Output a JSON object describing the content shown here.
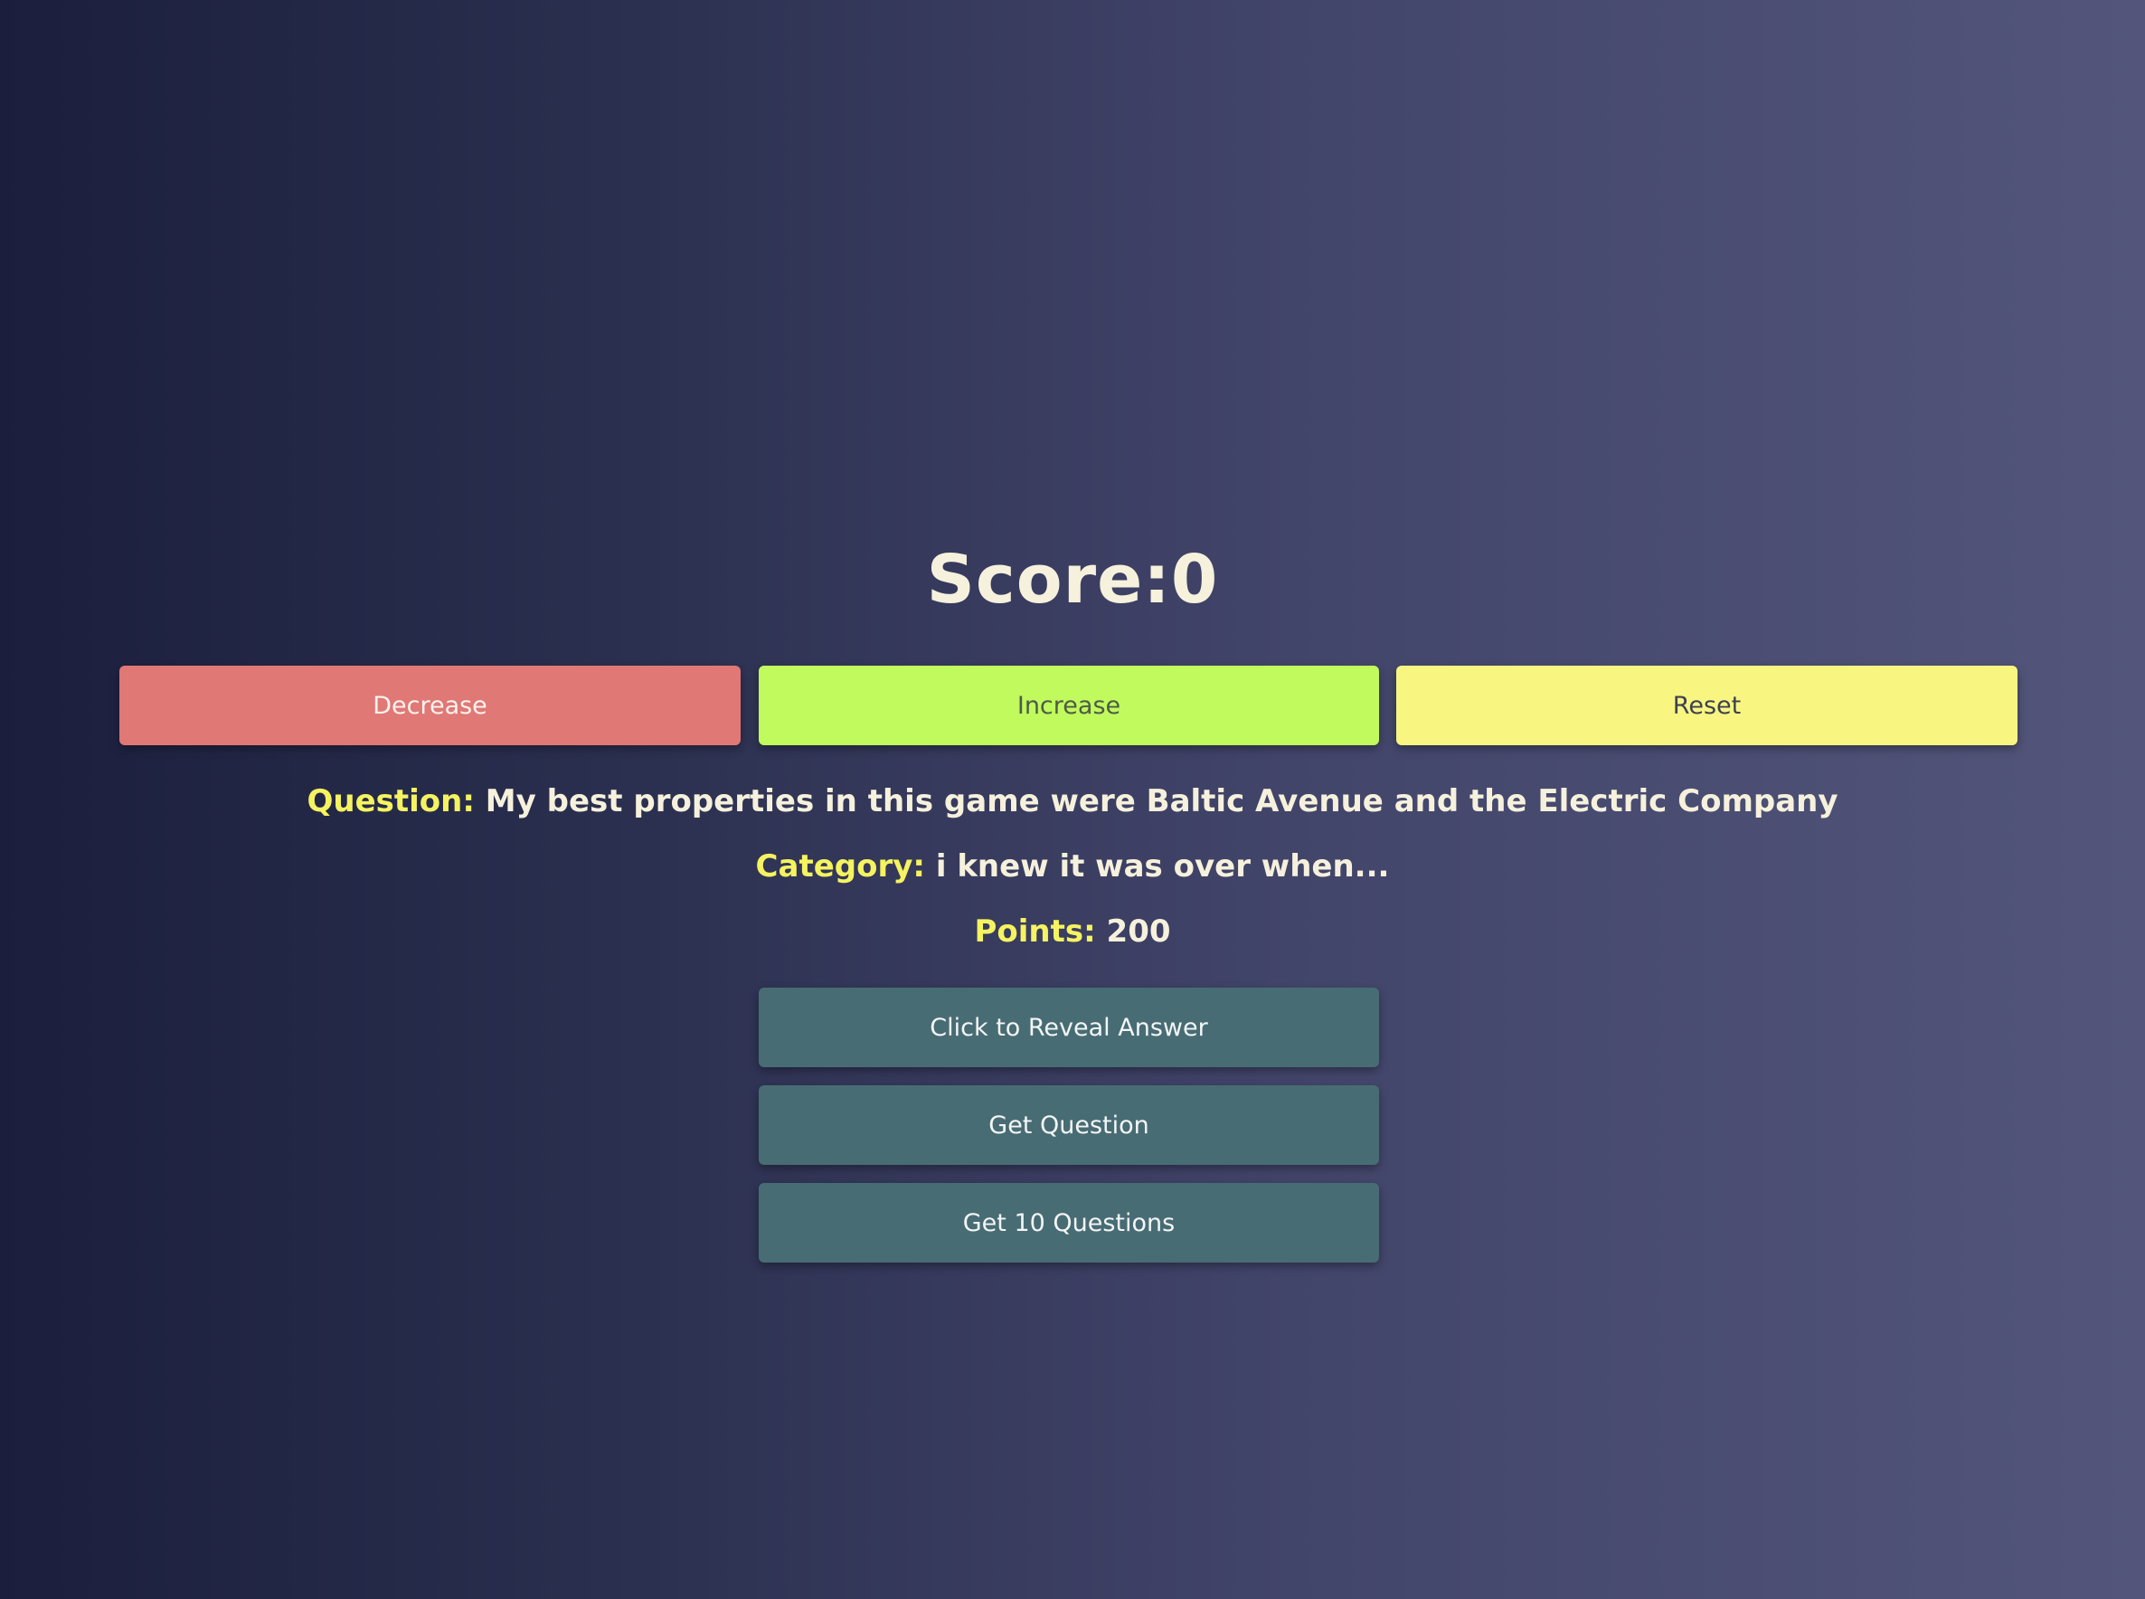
{
  "score": {
    "label": "Score:",
    "value": "0"
  },
  "controls": {
    "decrease_label": "Decrease",
    "increase_label": "Increase",
    "reset_label": "Reset"
  },
  "question": {
    "question_label": "Question:",
    "question_text": "My best properties in this game were Baltic Avenue and the Electric Company",
    "category_label": "Category:",
    "category_text": "i knew it was over when...",
    "points_label": "Points:",
    "points_value": "200"
  },
  "actions": {
    "reveal_label": "Click to Reveal Answer",
    "get_question_label": "Get Question",
    "get_ten_label": "Get 10 Questions"
  },
  "colors": {
    "decrease": "#e07875",
    "increase": "#c0fa5d",
    "reset": "#f8f681",
    "action": "#486c74",
    "label_accent": "#f5f360",
    "text": "#f6f1dc"
  }
}
